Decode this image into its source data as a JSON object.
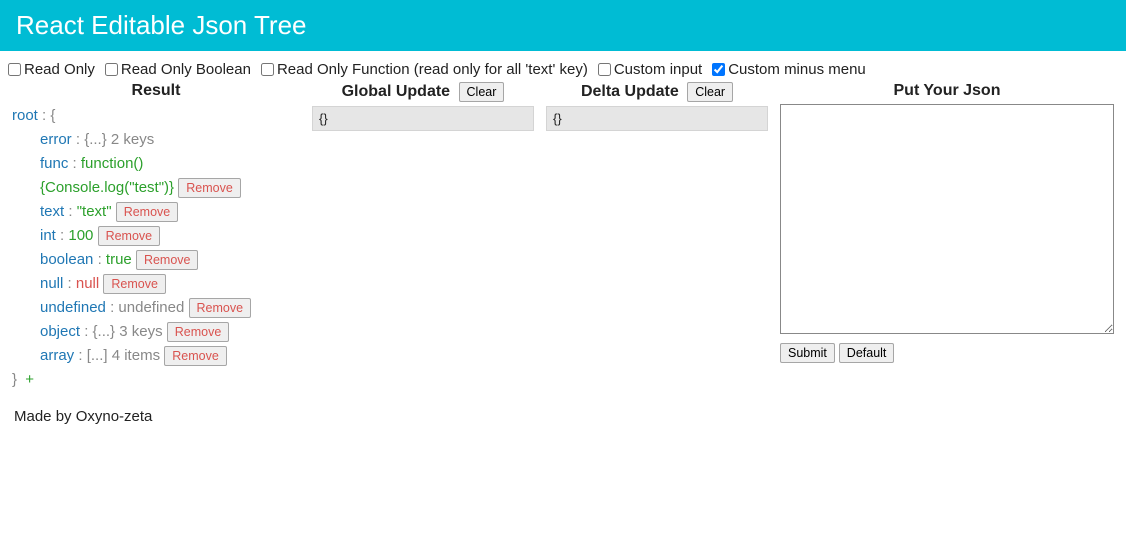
{
  "header": {
    "title": "React Editable Json Tree"
  },
  "checkboxes": {
    "readOnly": {
      "label": "Read Only",
      "checked": false
    },
    "readOnlyBoolean": {
      "label": "Read Only Boolean",
      "checked": false
    },
    "readOnlyFunction": {
      "label": "Read Only Function (read only for all 'text' key)",
      "checked": false
    },
    "customInput": {
      "label": "Custom input",
      "checked": false
    },
    "customMinusMenu": {
      "label": "Custom minus menu",
      "checked": true
    }
  },
  "columns": {
    "result": {
      "title": "Result"
    },
    "globalUpdate": {
      "title": "Global Update",
      "clear": "Clear",
      "content": "{}"
    },
    "deltaUpdate": {
      "title": "Delta Update",
      "clear": "Clear",
      "content": "{}"
    },
    "putJson": {
      "title": "Put Your Json",
      "submit": "Submit",
      "default": "Default"
    }
  },
  "tree": {
    "rootKey": "root",
    "openBrace": "{",
    "closeBrace": "}",
    "plus": "+",
    "removeLabel": "Remove",
    "nodes": {
      "error": {
        "key": "error",
        "collapsed": "{...}",
        "summary": "2 keys"
      },
      "func": {
        "key": "func",
        "signature": "function()",
        "body": "{Console.log(\"test\")}"
      },
      "text": {
        "key": "text",
        "value": "\"text\""
      },
      "int": {
        "key": "int",
        "value": "100"
      },
      "boolean": {
        "key": "boolean",
        "value": "true"
      },
      "null": {
        "key": "null",
        "value": "null"
      },
      "undefined": {
        "key": "undefined",
        "value": "undefined"
      },
      "object": {
        "key": "object",
        "collapsed": "{...}",
        "summary": "3 keys"
      },
      "array": {
        "key": "array",
        "collapsed": "[...]",
        "summary": "4 items"
      }
    }
  },
  "footer": {
    "text": "Made by Oxyno-zeta"
  }
}
